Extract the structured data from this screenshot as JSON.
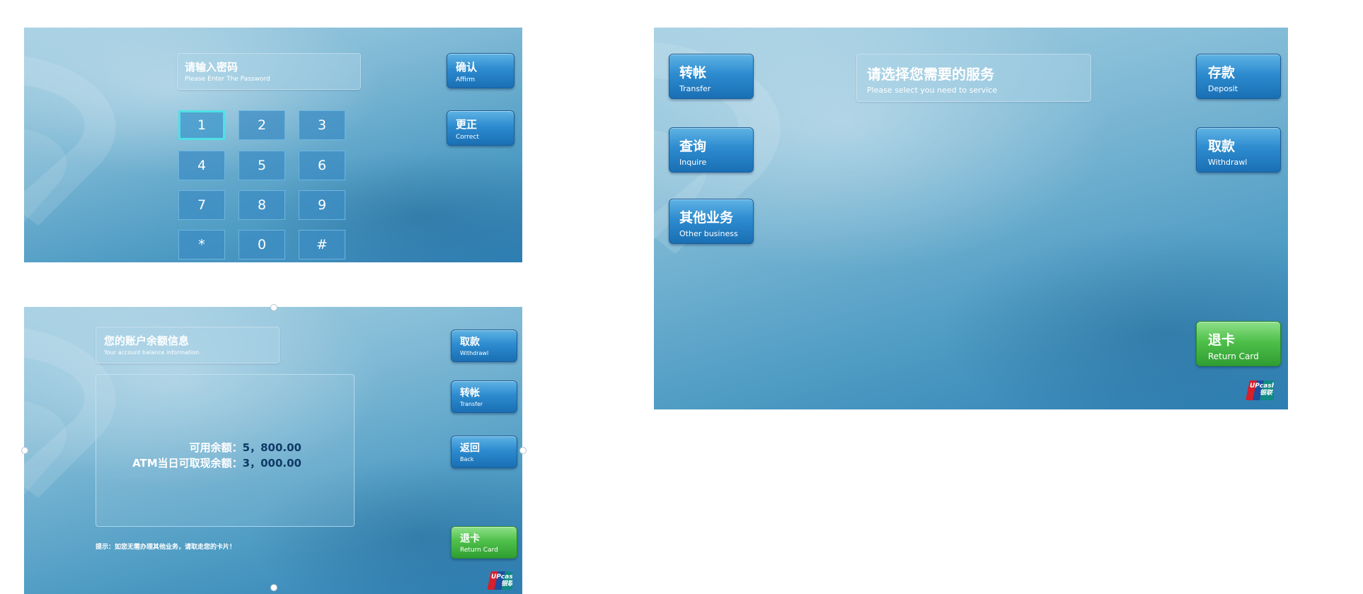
{
  "password_screen": {
    "prompt_cn": "请输入密码",
    "prompt_en": "Please Enter The Password",
    "affirm": {
      "cn": "确认",
      "en": "Affirm"
    },
    "correct": {
      "cn": "更正",
      "en": "Correct"
    },
    "keys": [
      "1",
      "2",
      "3",
      "4",
      "5",
      "6",
      "7",
      "8",
      "9",
      "*",
      "0",
      "#"
    ],
    "active_key": "1"
  },
  "service_screen": {
    "prompt_cn": "请选择您需要的服务",
    "prompt_en": "Please select you need to service",
    "transfer": {
      "cn": "转帐",
      "en": "Transfer"
    },
    "inquire": {
      "cn": "查询",
      "en": "Inquire"
    },
    "other": {
      "cn": "其他业务",
      "en": "Other business"
    },
    "deposit": {
      "cn": "存款",
      "en": "Deposit"
    },
    "withdraw": {
      "cn": "取款",
      "en": "Withdrawl"
    },
    "return_card": {
      "cn": "退卡",
      "en": "Return Card"
    },
    "brand_logo": "UPcash 银联"
  },
  "balance_screen": {
    "title_cn": "您的账户余额信息",
    "title_en": "Your account balance information",
    "available_label": "可用余额：",
    "available_value": "5，800.00",
    "atm_label": "ATM当日可取现余额：",
    "atm_value": "3，000.00",
    "hint": "提示：如您无需办理其他业务，请取走您的卡片！",
    "withdraw": {
      "cn": "取款",
      "en": "Withdrawl"
    },
    "transfer": {
      "cn": "转帐",
      "en": "Transfer"
    },
    "back": {
      "cn": "返回",
      "en": "Back"
    },
    "return_card": {
      "cn": "退卡",
      "en": "Return Card"
    },
    "brand_logo": "UPcash 银联"
  },
  "colors": {
    "button_blue": "#2d8bcf",
    "button_green": "#4fc04a",
    "key_highlight": "#4fe0e6"
  }
}
